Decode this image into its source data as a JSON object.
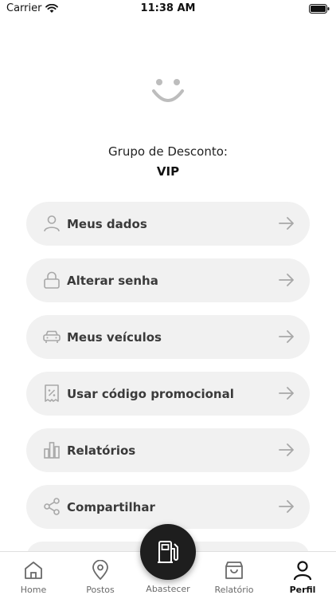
{
  "status_bar": {
    "carrier": "Carrier",
    "time": "11:38 AM"
  },
  "profile": {
    "avatar_icon": "smiley-face-icon",
    "group_label": "Grupo de Desconto:",
    "group_value": "VIP"
  },
  "menu": {
    "items": [
      {
        "label": "Meus dados",
        "icon": "user-icon"
      },
      {
        "label": "Alterar senha",
        "icon": "lock-icon"
      },
      {
        "label": "Meus veículos",
        "icon": "car-icon"
      },
      {
        "label": "Usar código promocional",
        "icon": "percent-tag-icon"
      },
      {
        "label": "Relatórios",
        "icon": "bar-chart-icon"
      },
      {
        "label": "Compartilhar",
        "icon": "share-icon"
      }
    ]
  },
  "tab_bar": {
    "tabs": [
      {
        "label": "Home",
        "icon": "home-icon"
      },
      {
        "label": "Postos",
        "icon": "map-pin-icon"
      },
      {
        "label": "Abastecer",
        "icon": "fuel-pump-icon"
      },
      {
        "label": "Relatório",
        "icon": "shopping-bag-icon"
      },
      {
        "label": "Perfil",
        "icon": "user-icon",
        "active": true
      }
    ]
  },
  "colors": {
    "menu_item_bg": "#f1f1f1",
    "icon_gray": "#a8a8a8",
    "fab_bg": "#1e1e1e",
    "active_tab": "#111111",
    "inactive_tab": "#6a6a6a"
  }
}
